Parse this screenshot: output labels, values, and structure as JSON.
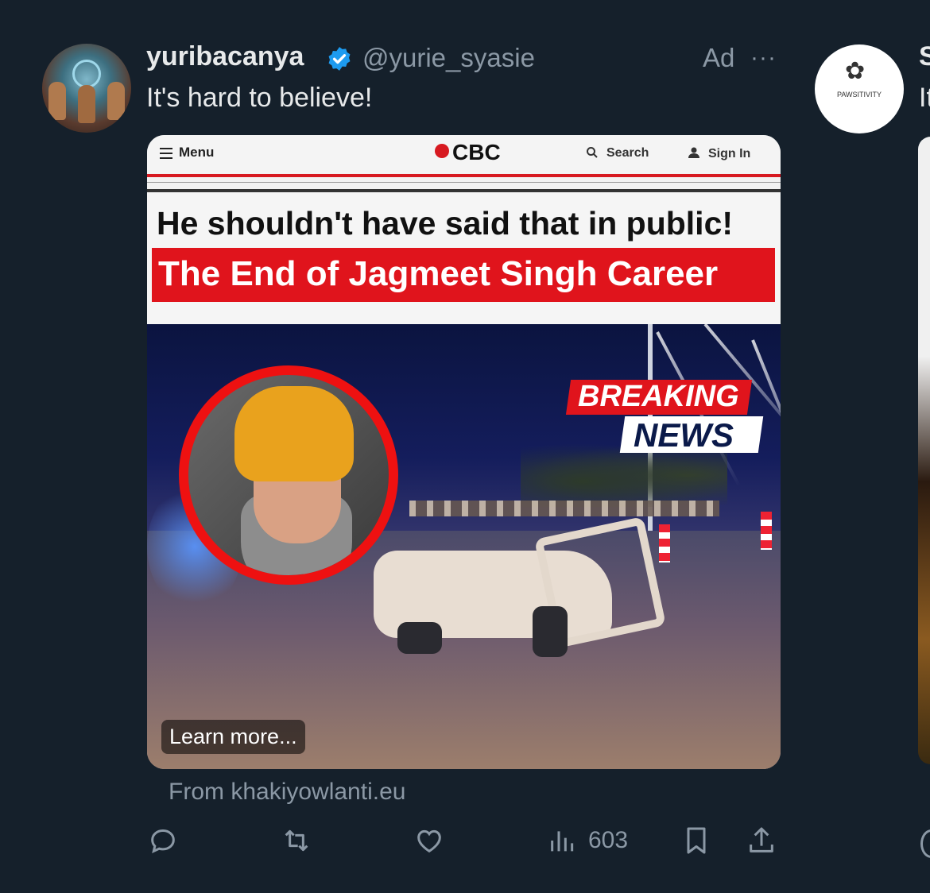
{
  "post": {
    "display_name": "yuribacanya",
    "handle": "@yurie_syasie",
    "ad_label": "Ad",
    "more_label": "···",
    "text": "It's hard to believe!",
    "source": "From khakiyowlanti.eu",
    "views": "603"
  },
  "ad_image": {
    "menu_label": "Menu",
    "logo": "CBC",
    "search_label": "Search",
    "signin_label": "Sign In",
    "headline": "He shouldn't have said that in public!",
    "red_headline": "The End of Jagmeet Singh Career",
    "breaking": "BREAKING",
    "news": "NEWS",
    "learn_more": "Learn more..."
  },
  "next_post": {
    "avatar_brand": "PAWSITIVITY",
    "name_initial": "S",
    "text_initial": "It"
  },
  "colors": {
    "background": "#15202b",
    "cbc_red": "#d71920",
    "verified_blue": "#1d9bf0",
    "muted": "#8b98a5"
  }
}
